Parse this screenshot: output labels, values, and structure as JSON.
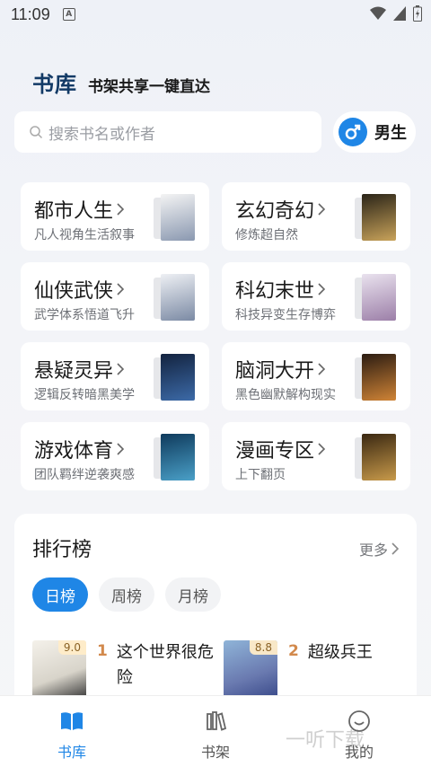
{
  "status_bar": {
    "time": "11:09",
    "notification_letter": "A"
  },
  "header": {
    "title": "书库",
    "subtitle": "书架共享一键直达"
  },
  "search": {
    "placeholder": "搜索书名或作者"
  },
  "gender_toggle": {
    "label": "男生",
    "icon": "male-symbol-icon",
    "color": "#1f86e6"
  },
  "categories": [
    {
      "title": "都市人生",
      "desc": "凡人视角生活叙事",
      "cover_colors": [
        "#f4f4f4",
        "#8a98b0"
      ]
    },
    {
      "title": "玄幻奇幻",
      "desc": "修炼超自然",
      "cover_colors": [
        "#2a2418",
        "#c9a35a"
      ]
    },
    {
      "title": "仙侠武侠",
      "desc": "武学体系悟道飞升",
      "cover_colors": [
        "#eef0f4",
        "#7b8aa4"
      ]
    },
    {
      "title": "科幻末世",
      "desc": "科技异变生存博弈",
      "cover_colors": [
        "#e9e2ee",
        "#9c7fa8"
      ]
    },
    {
      "title": "悬疑灵异",
      "desc": "逻辑反转暗黑美学",
      "cover_colors": [
        "#13233f",
        "#3c6aa8"
      ]
    },
    {
      "title": "脑洞大开",
      "desc": "黑色幽默解构现实",
      "cover_colors": [
        "#2b1c12",
        "#d08436"
      ]
    },
    {
      "title": "游戏体育",
      "desc": "团队羁绊逆袭爽感",
      "cover_colors": [
        "#0f3a5c",
        "#4aa0c8"
      ]
    },
    {
      "title": "漫画专区",
      "desc": "上下翻页",
      "cover_colors": [
        "#3a2812",
        "#c89a4a"
      ]
    }
  ],
  "ranking": {
    "title": "排行榜",
    "more_label": "更多",
    "tabs": [
      "日榜",
      "周榜",
      "月榜"
    ],
    "active_tab": "日榜",
    "books": [
      {
        "rank": "1",
        "name": "这个世界很危险",
        "score": "9.0",
        "cover_colors": [
          "#f4f1ea",
          "#3a3a3a"
        ]
      },
      {
        "rank": "2",
        "name": "超级兵王",
        "score": "8.8",
        "cover_colors": [
          "#8fb4d8",
          "#3a4a8a"
        ]
      }
    ]
  },
  "nav": {
    "items": [
      {
        "label": "书库",
        "icon": "open-book-icon",
        "active": true
      },
      {
        "label": "书架",
        "icon": "bookshelf-icon",
        "active": false
      },
      {
        "label": "我的",
        "icon": "smiley-face-icon",
        "active": false
      }
    ]
  },
  "watermark": {
    "text": "一听下载"
  },
  "accent_color": "#1f86e6"
}
